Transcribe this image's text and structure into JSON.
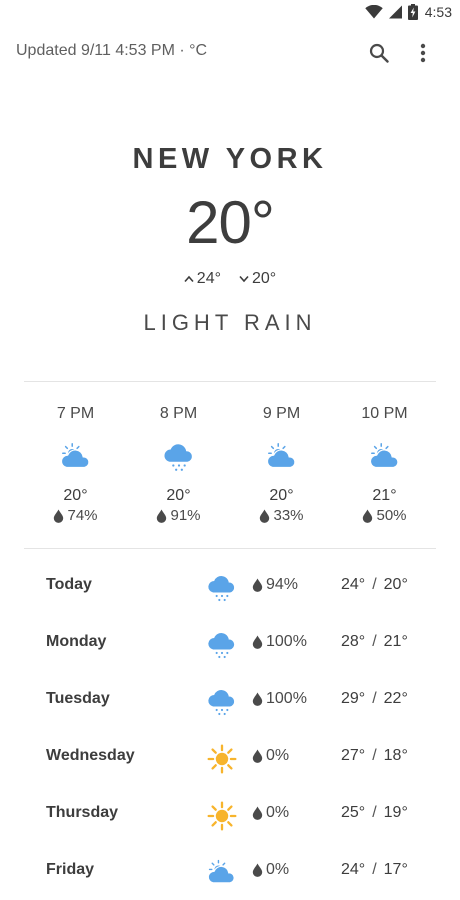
{
  "status_bar": {
    "time": "4:53"
  },
  "app_bar": {
    "updated_text": "Updated 9/11 4:53 PM · °C"
  },
  "current": {
    "city": "NEW YORK",
    "temperature": "20°",
    "high": "24°",
    "low": "20°",
    "condition": "LIGHT RAIN"
  },
  "hourly": [
    {
      "time": "7 PM",
      "icon": "partly-cloudy-icon",
      "temp": "20°",
      "precip": "74%"
    },
    {
      "time": "8 PM",
      "icon": "snow-cloud-icon",
      "temp": "20°",
      "precip": "91%"
    },
    {
      "time": "9 PM",
      "icon": "partly-cloudy-icon",
      "temp": "20°",
      "precip": "33%"
    },
    {
      "time": "10 PM",
      "icon": "partly-cloudy-icon",
      "temp": "21°",
      "precip": "50%"
    }
  ],
  "daily": [
    {
      "day": "Today",
      "icon": "snow-cloud-icon",
      "precip": "94%",
      "high": "24°",
      "low": "20°"
    },
    {
      "day": "Monday",
      "icon": "snow-cloud-icon",
      "precip": "100%",
      "high": "28°",
      "low": "21°"
    },
    {
      "day": "Tuesday",
      "icon": "snow-cloud-icon",
      "precip": "100%",
      "high": "29°",
      "low": "22°"
    },
    {
      "day": "Wednesday",
      "icon": "sun-icon",
      "precip": "0%",
      "high": "27°",
      "low": "18°"
    },
    {
      "day": "Thursday",
      "icon": "sun-icon",
      "precip": "0%",
      "high": "25°",
      "low": "19°"
    },
    {
      "day": "Friday",
      "icon": "partly-cloudy-icon",
      "precip": "0%",
      "high": "24°",
      "low": "17°"
    }
  ],
  "colors": {
    "icon_blue": "#5aa4e8",
    "sun_yellow": "#f7b42c",
    "text": "#3d3d3d"
  }
}
